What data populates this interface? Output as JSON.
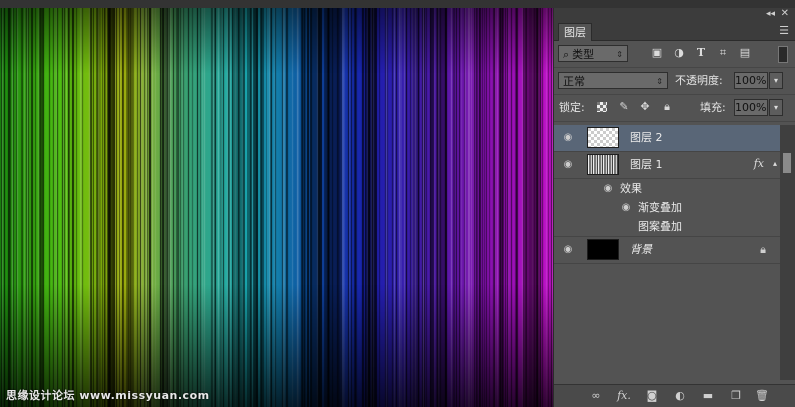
{
  "canvas": {
    "watermark": "思缘设计论坛 www.missyuan.com",
    "stripe_colors": [
      "#1a8a10",
      "#4fbf12",
      "#a8b80c",
      "#3aa070",
      "#1bb0b8",
      "#0c4f9f",
      "#1a20b0",
      "#4a1aa8",
      "#8a10b0",
      "#c010c8"
    ]
  },
  "panel": {
    "tab_label": "图层",
    "filter": {
      "label": "类型",
      "icons": [
        "image-filter-icon",
        "adjustment-filter-icon",
        "type-filter-icon",
        "shape-filter-icon",
        "smart-object-filter-icon"
      ]
    },
    "blend_mode": "正常",
    "opacity_label": "不透明度:",
    "opacity_value": "100%",
    "lock_label": "锁定:",
    "fill_label": "填充:",
    "fill_value": "100%",
    "layers": [
      {
        "name": "图层 2",
        "selected": true
      },
      {
        "name": "图层 1",
        "selected": false,
        "fx": "fx"
      },
      {
        "name": "背景",
        "selected": false
      }
    ],
    "effects": {
      "label": "效果",
      "items": [
        "渐变叠加",
        "图案叠加"
      ]
    }
  }
}
